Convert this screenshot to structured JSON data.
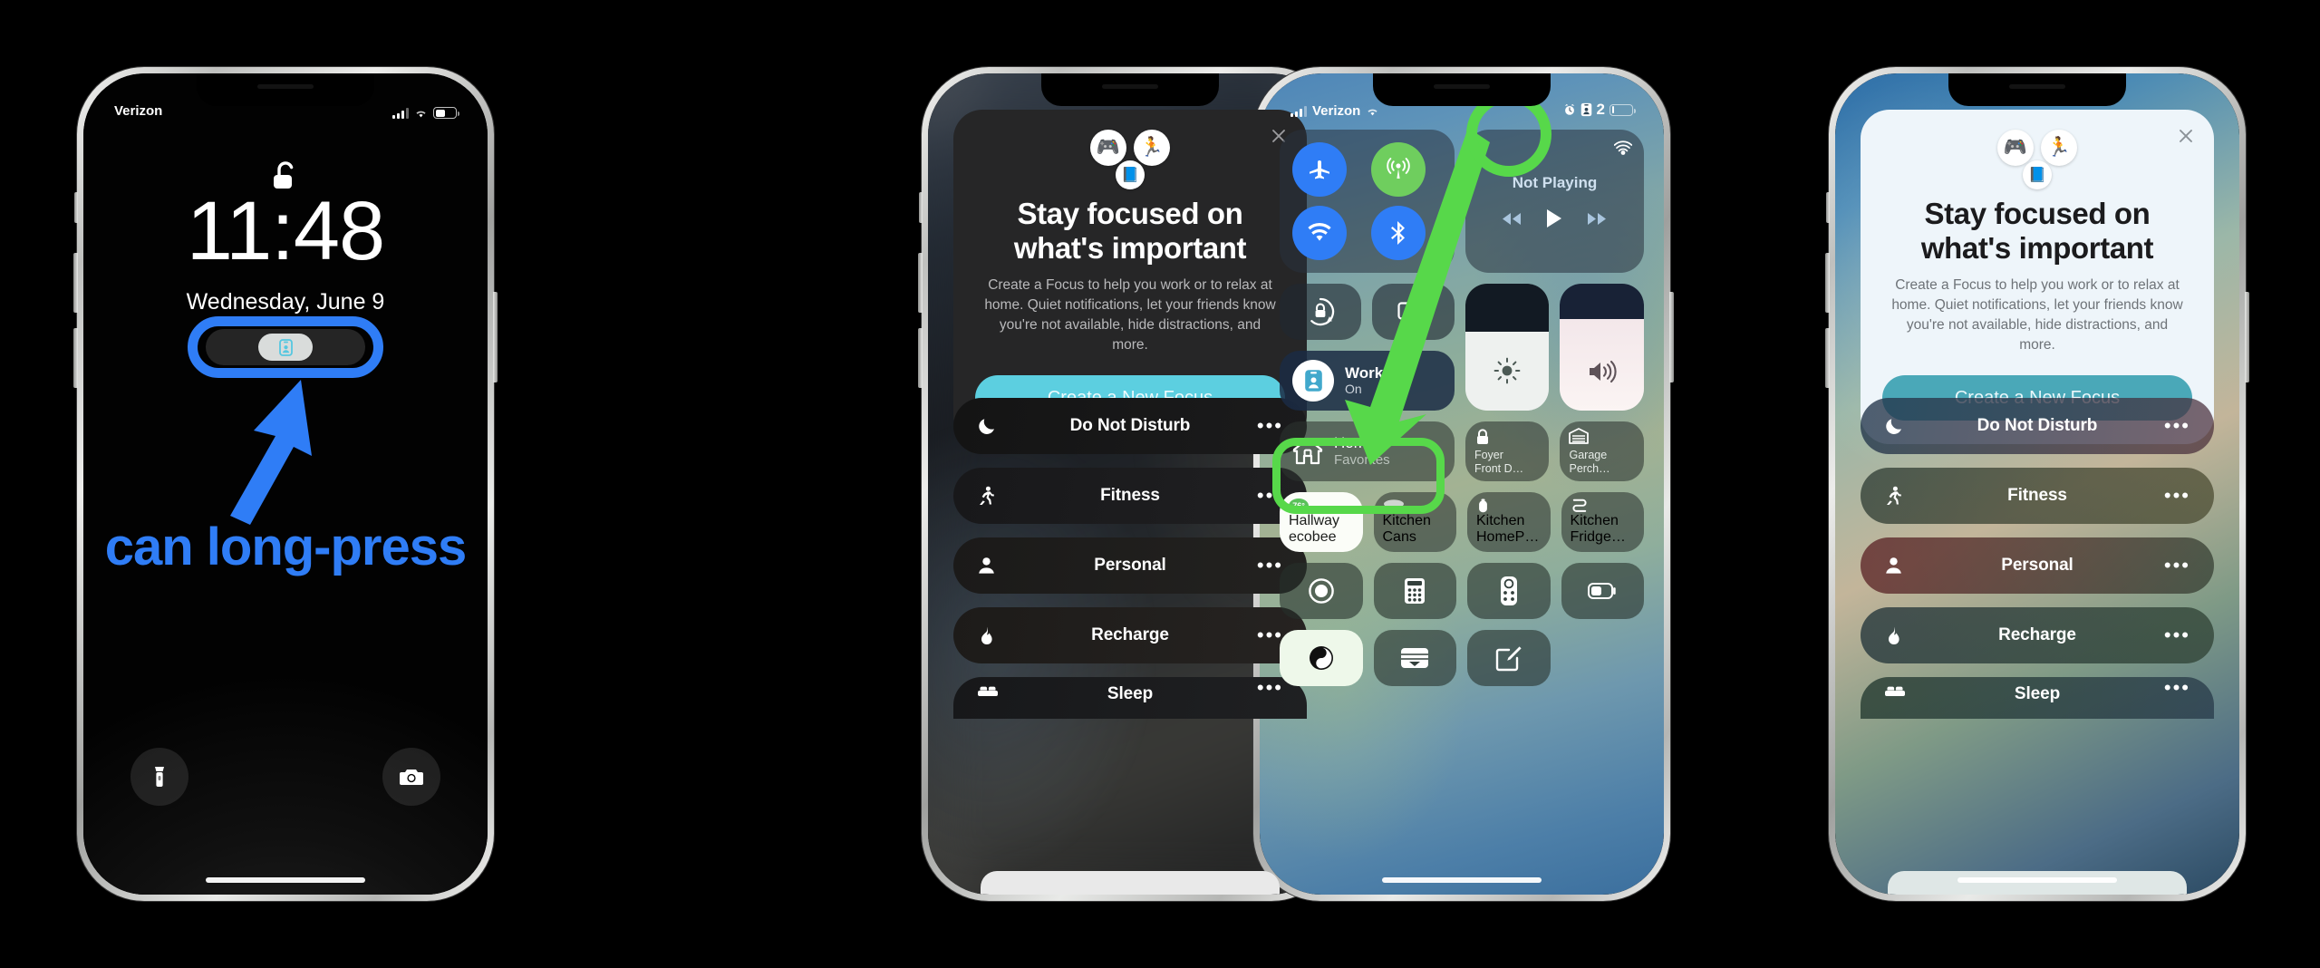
{
  "meta": {
    "accent_blue": "#2f7df6",
    "accent_green": "#57d84a",
    "teal_button": "#5ccfe0"
  },
  "phone1": {
    "name": "lock-screen",
    "status_carrier": "Verizon",
    "time": "11:48",
    "date": "Wednesday, June 9",
    "focus_pill_icon": "work-focus-icon",
    "lock_icon": "unlocked-padlock-icon",
    "annotation_text": "can long-press",
    "flashlight_icon": "flashlight-icon",
    "camera_icon": "camera-icon"
  },
  "phone2": {
    "name": "focus-setup-sheet-dark",
    "card": {
      "close_icon": "close-icon",
      "emoji": [
        "🎮",
        "🏃",
        "📘"
      ],
      "title": "Stay focused on what's important",
      "body": "Create a Focus to help you work or to relax at home. Quiet notifications, let your friends know you're not available, hide distractions, and more.",
      "button_label": "Create a New Focus"
    },
    "focus_items": [
      {
        "label": "Do Not Disturb",
        "icon": "moon-icon",
        "more": "•••"
      },
      {
        "label": "Fitness",
        "icon": "running-person-icon",
        "more": "•••"
      },
      {
        "label": "Personal",
        "icon": "person-icon",
        "more": "•••"
      },
      {
        "label": "Recharge",
        "icon": "flame-drop-icon",
        "more": "•••"
      },
      {
        "label": "Sleep",
        "icon": "bed-icon",
        "more": "•••"
      }
    ]
  },
  "phone3": {
    "name": "control-center",
    "status": {
      "carrier": "Verizon",
      "signal_icon": "cellular-bars-icon",
      "wifi_icon": "wifi-icon",
      "alarm_icon": "alarm-clock-icon",
      "focus_icon": "work-focus-icon",
      "location_count": "2",
      "battery_icon": "battery-icon"
    },
    "connectivity": [
      {
        "icon": "airplane-mode-icon",
        "state": "off"
      },
      {
        "icon": "cellular-data-icon",
        "state": "on"
      },
      {
        "icon": "wifi-icon",
        "state": "on"
      },
      {
        "icon": "bluetooth-icon",
        "state": "on"
      }
    ],
    "media": {
      "title": "Not Playing",
      "airplay_icon": "airplay-icon",
      "prev_icon": "rewind-icon",
      "play_icon": "play-icon",
      "next_icon": "fast-forward-icon"
    },
    "tiles": [
      {
        "icon": "rotation-lock-icon"
      },
      {
        "icon": "screen-mirroring-icon"
      }
    ],
    "focus_tile": {
      "icon": "work-focus-icon",
      "title": "Work",
      "status": "On"
    },
    "sliders": [
      {
        "icon": "brightness-icon",
        "name": "brightness-slider"
      },
      {
        "icon": "volume-icon",
        "name": "volume-slider"
      }
    ],
    "home": {
      "title": "Home",
      "subtitle": "Favorites",
      "icon": "house-icon",
      "tiles": [
        {
          "label": "Foyer\nFront D…",
          "icon": "lock-icon",
          "on": false
        },
        {
          "label": "Garage\nPerch…",
          "icon": "garage-icon",
          "on": false
        },
        {
          "label": "Hallway\necobee",
          "icon": "thermostat-icon",
          "badge": "76°",
          "on": true
        },
        {
          "label": "Kitchen\nCans",
          "icon": "ceiling-light-icon",
          "on": false
        },
        {
          "label": "Kitchen\nHomeP…",
          "icon": "homepod-icon",
          "on": false
        },
        {
          "label": "Kitchen\nFridge…",
          "icon": "outlet-strip-icon",
          "on": false
        }
      ]
    },
    "apps": [
      {
        "icon": "screen-record-icon",
        "on": false
      },
      {
        "icon": "calculator-icon",
        "on": false
      },
      {
        "icon": "apple-tv-remote-icon",
        "on": false
      },
      {
        "icon": "low-power-mode-icon",
        "on": false
      },
      {
        "icon": "dark-mode-icon",
        "on": true
      },
      {
        "icon": "wallet-icon",
        "on": false
      },
      {
        "icon": "notes-icon",
        "on": false
      }
    ]
  },
  "phone4": {
    "name": "focus-setup-sheet-light",
    "card": {
      "close_icon": "close-icon",
      "emoji": [
        "🎮",
        "🏃",
        "📘"
      ],
      "title": "Stay focused on what's important",
      "body": "Create a Focus to help you work or to relax at home. Quiet notifications, let your friends know you're not available, hide distractions, and more.",
      "button_label": "Create a New Focus"
    },
    "focus_items": [
      {
        "label": "Do Not Disturb",
        "icon": "moon-icon",
        "more": "•••"
      },
      {
        "label": "Fitness",
        "icon": "running-person-icon",
        "more": "•••"
      },
      {
        "label": "Personal",
        "icon": "person-icon",
        "more": "•••"
      },
      {
        "label": "Recharge",
        "icon": "flame-drop-icon",
        "more": "•••"
      },
      {
        "label": "Sleep",
        "icon": "bed-icon",
        "more": "•••"
      }
    ]
  }
}
